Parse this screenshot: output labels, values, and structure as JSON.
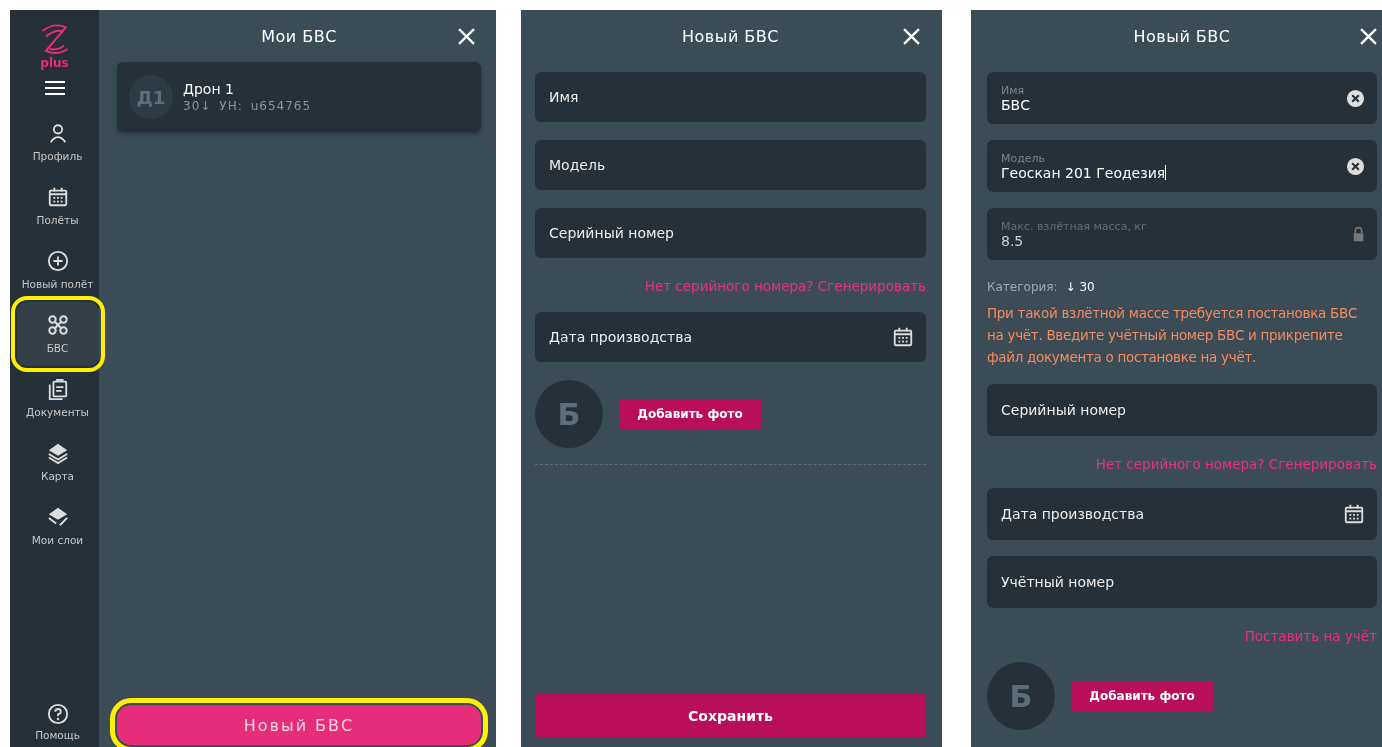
{
  "my_drones": {
    "sidebar": {
      "logo_text": "plus",
      "items": [
        {
          "label": "Профиль",
          "selected": false,
          "highlighted": false
        },
        {
          "label": "Полёты",
          "selected": false,
          "highlighted": false
        },
        {
          "label": "Новый полёт",
          "selected": false,
          "highlighted": false
        },
        {
          "label": "БВС",
          "selected": true,
          "highlighted": true
        },
        {
          "label": "Документы",
          "selected": false,
          "highlighted": false
        },
        {
          "label": "Карта",
          "selected": false,
          "highlighted": false
        },
        {
          "label": "Мои слои",
          "selected": false,
          "highlighted": false
        }
      ],
      "help": {
        "label": "Помощь"
      }
    },
    "title": "Мои БВС",
    "drones": [
      {
        "avatar": "Д1",
        "name": "Дрон 1",
        "category": "30↓",
        "reg_label": "УН:",
        "reg": "u654765"
      }
    ],
    "button": {
      "label": "Новый БВС",
      "highlighted": true
    }
  },
  "forms": [
    {
      "title": "Новый БВС",
      "items": [
        {
          "kind": "field",
          "label": "Имя"
        },
        {
          "kind": "field",
          "label": "Модель"
        },
        {
          "kind": "field",
          "label": "Серийный номер"
        },
        {
          "kind": "link",
          "text": "Нет серийного номера? Сгенерировать"
        },
        {
          "kind": "date-field",
          "label": "Дата производства"
        },
        {
          "kind": "photo",
          "avatar": "Б",
          "button": "Добавить фото"
        },
        {
          "kind": "divider"
        }
      ],
      "save": "Сохранить"
    },
    {
      "title": "Новый БВС",
      "items": [
        {
          "kind": "field",
          "label": "Имя",
          "value": "БВС",
          "disabled": false
        },
        {
          "kind": "field",
          "label": "Модель",
          "value": "Геоскан 201 Геодезия",
          "focused": true,
          "disabled": false
        },
        {
          "kind": "field",
          "label": "Макс. взлётная масса, кг",
          "value": "8.5",
          "disabled": true
        },
        {
          "kind": "category",
          "label": "Категория:",
          "value": "↓ 30"
        },
        {
          "kind": "warning",
          "text": "При такой взлётной массе требуется постановка БВС на учёт. Введите учётный номер БВС и прикрепите файл документа о постановке на учёт."
        },
        {
          "kind": "field",
          "label": "Серийный номер"
        },
        {
          "kind": "link",
          "text": "Нет серийного номера? Сгенерировать"
        },
        {
          "kind": "date-field",
          "label": "Дата производства"
        },
        {
          "kind": "field",
          "label": "Учётный номер"
        },
        {
          "kind": "link",
          "text": "Поставить на учёт"
        },
        {
          "kind": "photo",
          "avatar": "Б",
          "button": "Добавить фото"
        }
      ]
    }
  ]
}
